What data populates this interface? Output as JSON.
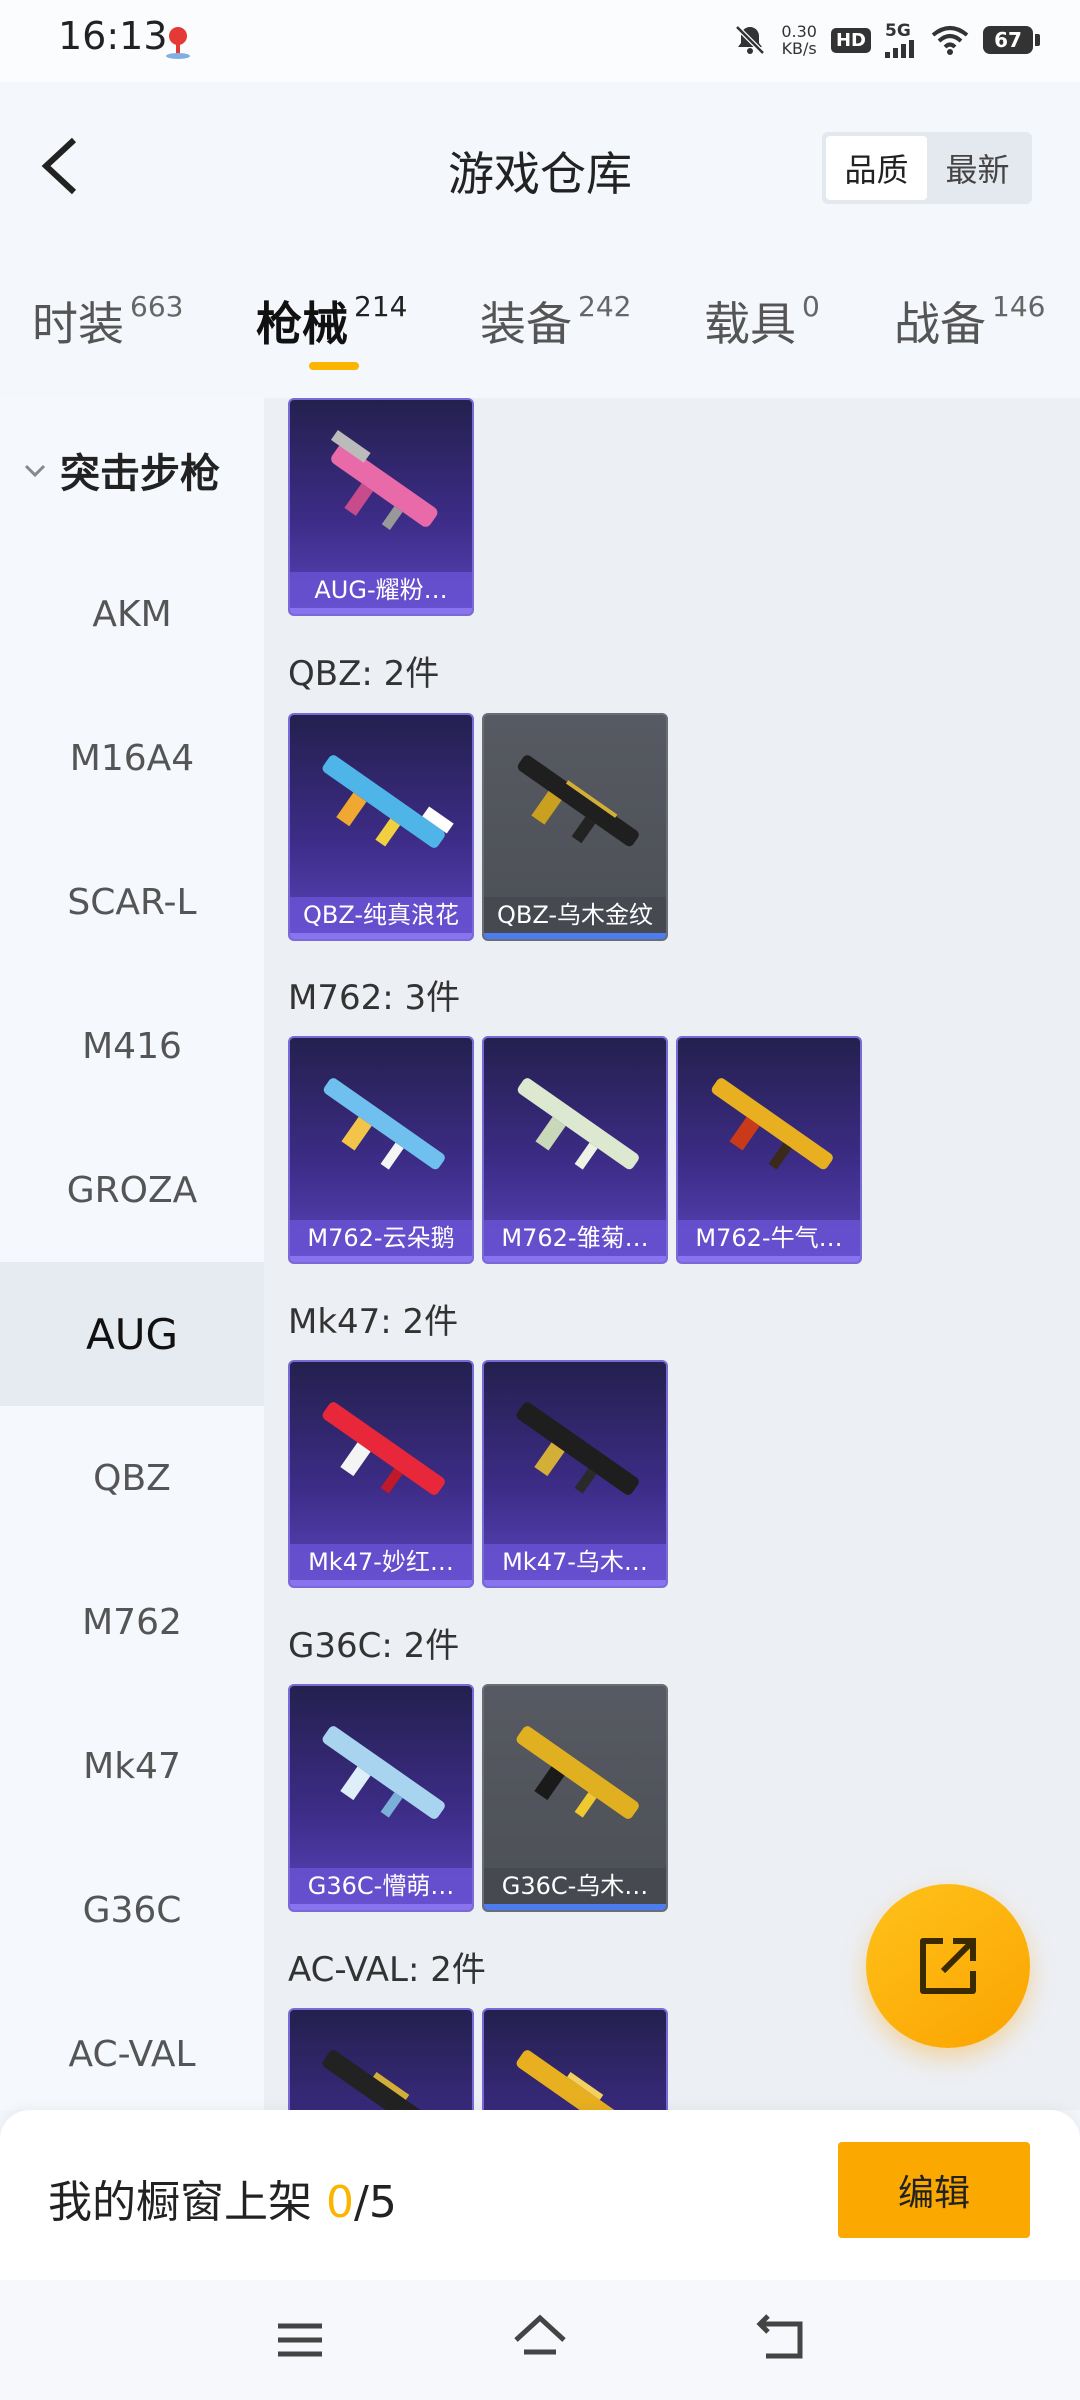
{
  "status_bar": {
    "time": "16:13",
    "net_speed_value": "0.30",
    "net_speed_unit": "KB/s",
    "hd_label": "HD",
    "network_label": "5G",
    "battery": "67"
  },
  "header": {
    "title": "游戏仓库",
    "sort_options": [
      "品质",
      "最新"
    ]
  },
  "tabs": [
    {
      "label": "时装",
      "count": "663"
    },
    {
      "label": "枪械",
      "count": "214"
    },
    {
      "label": "装备",
      "count": "242"
    },
    {
      "label": "载具",
      "count": "0"
    },
    {
      "label": "战备",
      "count": "146"
    }
  ],
  "sidebar": {
    "category": "突击步枪",
    "items": [
      "AKM",
      "M16A4",
      "SCAR-L",
      "M416",
      "GROZA",
      "AUG",
      "QBZ",
      "M762",
      "Mk47",
      "G36C",
      "AC-VAL"
    ]
  },
  "groups": [
    {
      "title": "",
      "items": [
        {
          "name": "AUG-耀粉…",
          "style": "purple"
        }
      ]
    },
    {
      "title": "QBZ: 2件",
      "items": [
        {
          "name": "QBZ-纯真浪花",
          "style": "purple"
        },
        {
          "name": "QBZ-乌木金纹",
          "style": "grey"
        }
      ]
    },
    {
      "title": "M762: 3件",
      "items": [
        {
          "name": "M762-云朵鹅",
          "style": "purple"
        },
        {
          "name": "M762-雏菊…",
          "style": "purple"
        },
        {
          "name": "M762-牛气…",
          "style": "purple"
        }
      ]
    },
    {
      "title": "Mk47: 2件",
      "items": [
        {
          "name": "Mk47-妙红…",
          "style": "purple"
        },
        {
          "name": "Mk47-乌木…",
          "style": "purple"
        }
      ]
    },
    {
      "title": "G36C: 2件",
      "items": [
        {
          "name": "G36C-懵萌…",
          "style": "purple"
        },
        {
          "name": "G36C-乌木…",
          "style": "grey"
        }
      ]
    },
    {
      "title": "AC-VAL: 2件",
      "items": [
        {
          "name": "",
          "style": "purple"
        },
        {
          "name": "",
          "style": "purple"
        }
      ]
    }
  ],
  "bottom": {
    "showcase_label": "我的橱窗上架 ",
    "showcase_current": "0",
    "showcase_total": "/5",
    "edit_label": "编辑"
  },
  "colors": {
    "accent": "#fbb500",
    "card_purple": "#3c2c86",
    "card_grey": "#4c4f56"
  },
  "icons": [
    "back-arrow-icon",
    "chevron-down-icon",
    "share-out-icon",
    "menu-icon",
    "home-icon",
    "back-icon"
  ]
}
